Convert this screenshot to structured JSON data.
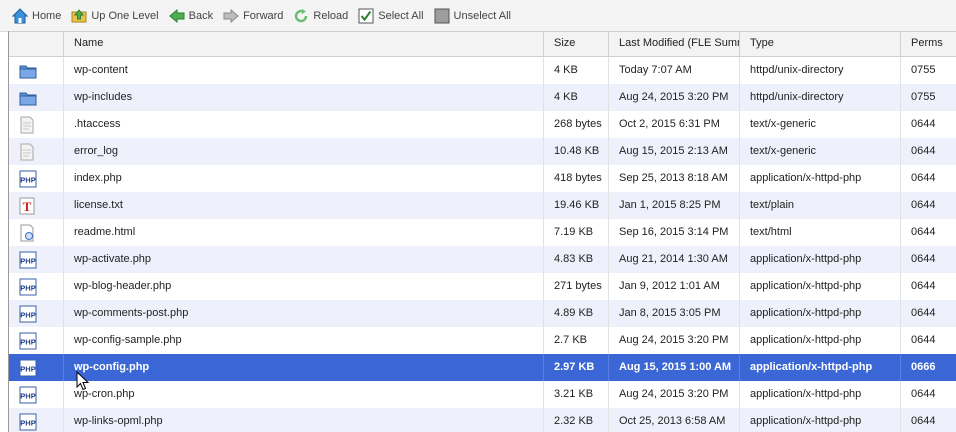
{
  "toolbar": {
    "home": "Home",
    "up_one_level": "Up One Level",
    "back": "Back",
    "forward": "Forward",
    "reload": "Reload",
    "select_all": "Select All",
    "unselect_all": "Unselect All"
  },
  "columns": {
    "name": "Name",
    "size": "Size",
    "last_modified": "Last Modified (FLE Summ",
    "type": "Type",
    "perms": "Perms"
  },
  "files": [
    {
      "icon": "folder-icon",
      "name": "wp-content",
      "size": "4 KB",
      "modified": "Today 7:07 AM",
      "type": "httpd/unix-directory",
      "perms": "0755"
    },
    {
      "icon": "folder-icon",
      "name": "wp-includes",
      "size": "4 KB",
      "modified": "Aug 24, 2015 3:20 PM",
      "type": "httpd/unix-directory",
      "perms": "0755"
    },
    {
      "icon": "generic-file-icon",
      "name": ".htaccess",
      "size": "268 bytes",
      "modified": "Oct 2, 2015 6:31 PM",
      "type": "text/x-generic",
      "perms": "0644"
    },
    {
      "icon": "generic-file-icon",
      "name": "error_log",
      "size": "10.48 KB",
      "modified": "Aug 15, 2015 2:13 AM",
      "type": "text/x-generic",
      "perms": "0644"
    },
    {
      "icon": "php-file-icon",
      "name": "index.php",
      "size": "418 bytes",
      "modified": "Sep 25, 2013 8:18 AM",
      "type": "application/x-httpd-php",
      "perms": "0644"
    },
    {
      "icon": "text-file-icon",
      "name": "license.txt",
      "size": "19.46 KB",
      "modified": "Jan 1, 2015 8:25 PM",
      "type": "text/plain",
      "perms": "0644"
    },
    {
      "icon": "html-file-icon",
      "name": "readme.html",
      "size": "7.19 KB",
      "modified": "Sep 16, 2015 3:14 PM",
      "type": "text/html",
      "perms": "0644"
    },
    {
      "icon": "php-file-icon",
      "name": "wp-activate.php",
      "size": "4.83 KB",
      "modified": "Aug 21, 2014 1:30 AM",
      "type": "application/x-httpd-php",
      "perms": "0644"
    },
    {
      "icon": "php-file-icon",
      "name": "wp-blog-header.php",
      "size": "271 bytes",
      "modified": "Jan 9, 2012 1:01 AM",
      "type": "application/x-httpd-php",
      "perms": "0644"
    },
    {
      "icon": "php-file-icon",
      "name": "wp-comments-post.php",
      "size": "4.89 KB",
      "modified": "Jan 8, 2015 3:05 PM",
      "type": "application/x-httpd-php",
      "perms": "0644"
    },
    {
      "icon": "php-file-icon",
      "name": "wp-config-sample.php",
      "size": "2.7 KB",
      "modified": "Aug 24, 2015 3:20 PM",
      "type": "application/x-httpd-php",
      "perms": "0644"
    },
    {
      "icon": "php-file-icon",
      "name": "wp-config.php",
      "size": "2.97 KB",
      "modified": "Aug 15, 2015 1:00 AM",
      "type": "application/x-httpd-php",
      "perms": "0666",
      "selected": true
    },
    {
      "icon": "php-file-icon",
      "name": "wp-cron.php",
      "size": "3.21 KB",
      "modified": "Aug 24, 2015 3:20 PM",
      "type": "application/x-httpd-php",
      "perms": "0644"
    },
    {
      "icon": "php-file-icon",
      "name": "wp-links-opml.php",
      "size": "2.32 KB",
      "modified": "Oct 25, 2013 6:58 AM",
      "type": "application/x-httpd-php",
      "perms": "0644"
    }
  ],
  "colors": {
    "selected_row": "#3a66d6",
    "alt_row": "#eef1fb",
    "toolbar_bg": "#f4f4f4",
    "header_bg": "#f3f3f3"
  }
}
